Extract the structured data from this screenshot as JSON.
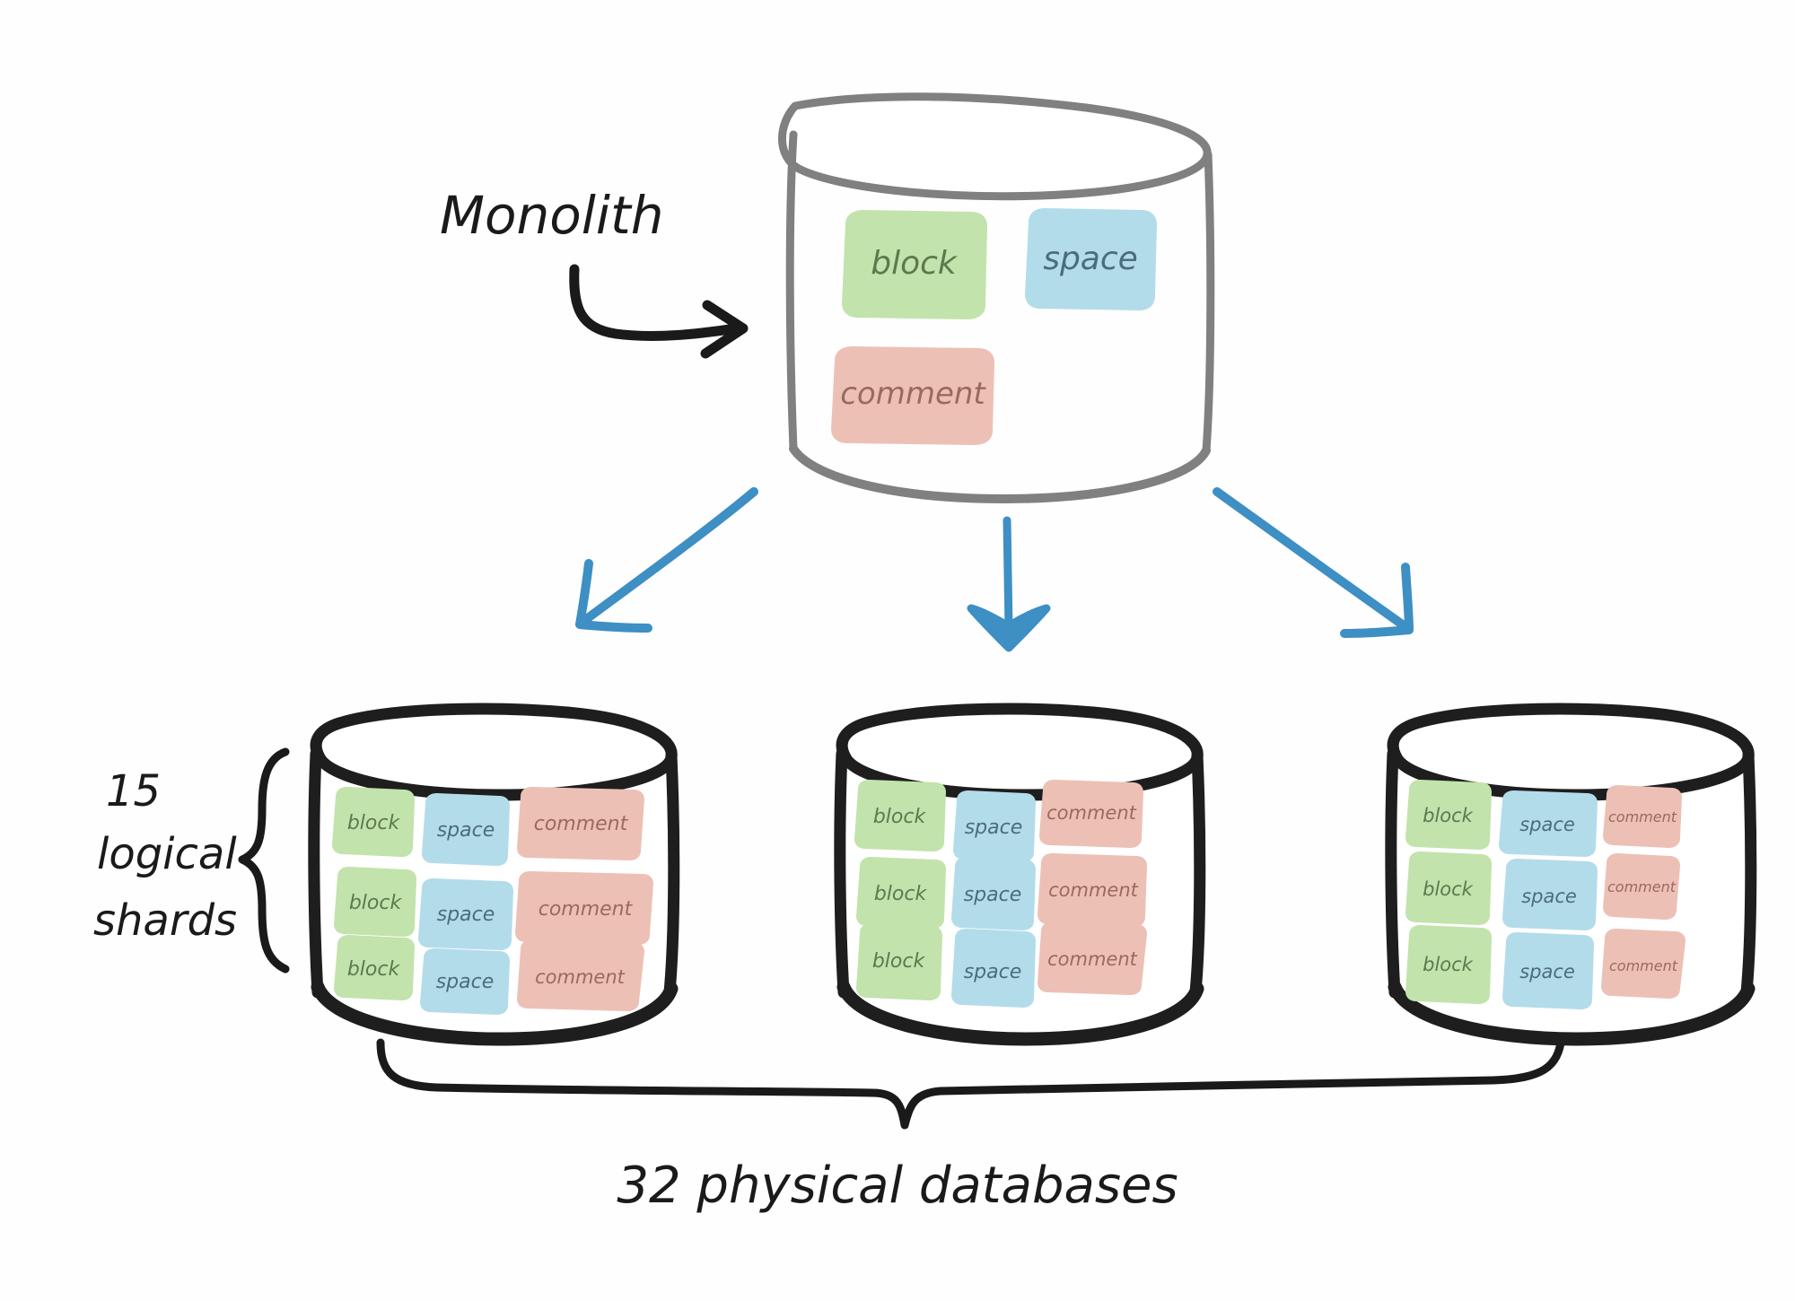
{
  "diagram": {
    "title_label": "Monolith",
    "left_annotation": {
      "line1": "15",
      "line2": "logical",
      "line3": "shards"
    },
    "bottom_annotation": "32  physical databases",
    "monolith": {
      "name": "monolith-database",
      "tables": [
        {
          "label": "block",
          "kind": "block"
        },
        {
          "label": "space",
          "kind": "space"
        },
        {
          "label": "comment",
          "kind": "comment"
        }
      ]
    },
    "shards": [
      {
        "name": "shard-database-1",
        "rows": [
          [
            {
              "label": "block",
              "kind": "block"
            },
            {
              "label": "space",
              "kind": "space"
            },
            {
              "label": "comment",
              "kind": "comment"
            }
          ],
          [
            {
              "label": "block",
              "kind": "block"
            },
            {
              "label": "space",
              "kind": "space"
            },
            {
              "label": "comment",
              "kind": "comment"
            }
          ],
          [
            {
              "label": "block",
              "kind": "block"
            },
            {
              "label": "space",
              "kind": "space"
            },
            {
              "label": "comment",
              "kind": "comment"
            }
          ]
        ]
      },
      {
        "name": "shard-database-2",
        "rows": [
          [
            {
              "label": "block",
              "kind": "block"
            },
            {
              "label": "space",
              "kind": "space"
            },
            {
              "label": "comment",
              "kind": "comment"
            }
          ],
          [
            {
              "label": "block",
              "kind": "block"
            },
            {
              "label": "space",
              "kind": "space"
            },
            {
              "label": "comment",
              "kind": "comment"
            }
          ],
          [
            {
              "label": "block",
              "kind": "block"
            },
            {
              "label": "space",
              "kind": "space"
            },
            {
              "label": "comment",
              "kind": "comment"
            }
          ]
        ]
      },
      {
        "name": "shard-database-3",
        "rows": [
          [
            {
              "label": "block",
              "kind": "block"
            },
            {
              "label": "space",
              "kind": "space"
            },
            {
              "label": "comment",
              "kind": "comment"
            }
          ],
          [
            {
              "label": "block",
              "kind": "block"
            },
            {
              "label": "space",
              "kind": "space"
            },
            {
              "label": "comment",
              "kind": "comment"
            }
          ],
          [
            {
              "label": "block",
              "kind": "block"
            },
            {
              "label": "space",
              "kind": "space"
            },
            {
              "label": "comment",
              "kind": "comment"
            }
          ]
        ]
      }
    ],
    "arrows": [
      {
        "name": "arrow-monolith-to-shard-1",
        "direction": "down-left"
      },
      {
        "name": "arrow-monolith-to-shard-2",
        "direction": "down"
      },
      {
        "name": "arrow-monolith-to-shard-3",
        "direction": "down-right"
      }
    ],
    "colors": {
      "block_fill": "#c2e3ab",
      "block_text": "#5c7a4e",
      "space_fill": "#b3dcea",
      "space_text": "#4a6d7c",
      "comment_fill": "#edc0b6",
      "comment_text": "#9a6a5e",
      "monolith_outline": "#808080",
      "shard_outline": "#1e1e1e",
      "arrow_blue": "#3d8fc4",
      "ink": "#1a1a1a",
      "background": "#ffffff"
    }
  }
}
